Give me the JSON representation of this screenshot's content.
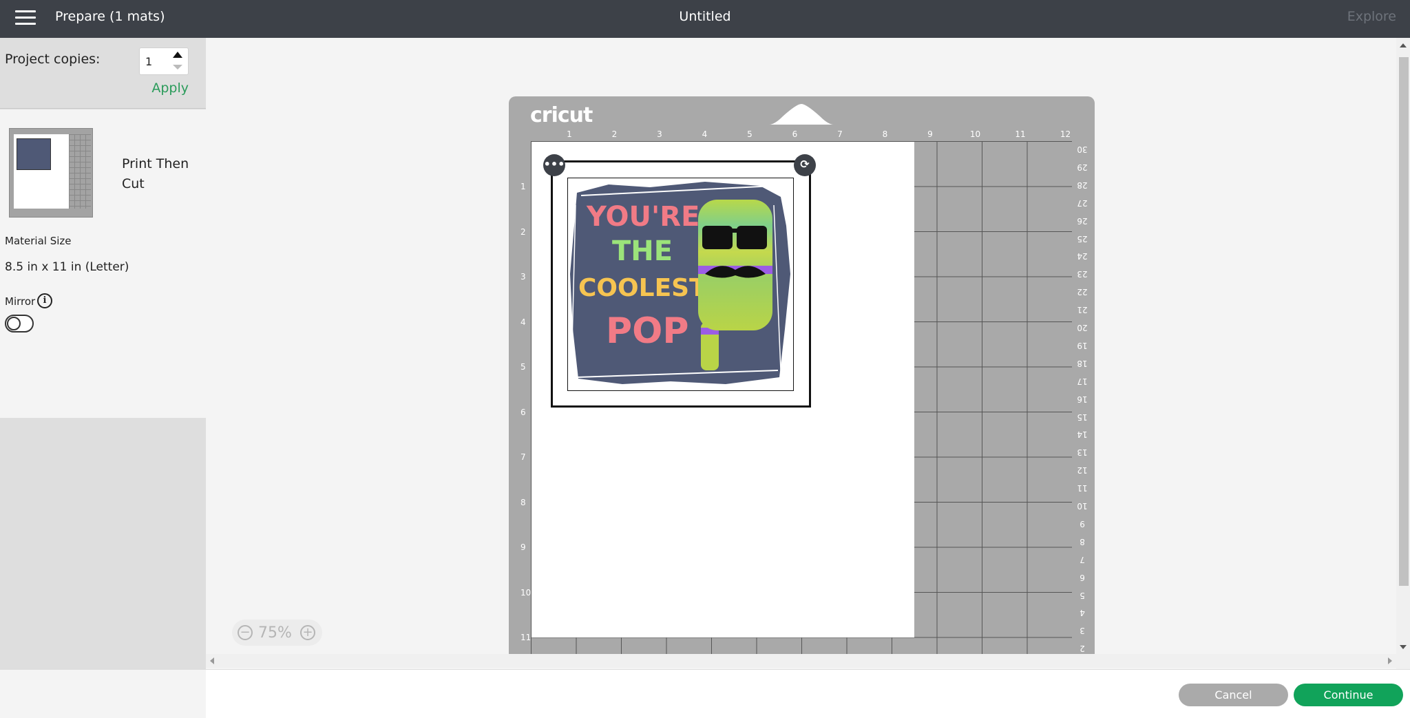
{
  "header": {
    "menu_icon": "hamburger-menu-icon",
    "title": "Prepare (1 mats)",
    "document_title": "Untitled",
    "explore_label": "Explore"
  },
  "left_panel": {
    "project_copies_label": "Project copies:",
    "project_copies_value": "1",
    "apply_label": "Apply",
    "mat": {
      "label": "Print Then Cut",
      "material_size_label": "Material Size",
      "material_size_value": "8.5 in x 11 in (Letter)",
      "mirror_label": "Mirror",
      "mirror_on": false
    }
  },
  "mat_view": {
    "logo_text": "cricut",
    "ruler_top": [
      "1",
      "2",
      "3",
      "4",
      "5",
      "6",
      "7",
      "8",
      "9",
      "10",
      "11",
      "12"
    ],
    "ruler_left": [
      "1",
      "2",
      "3",
      "4",
      "5",
      "6",
      "7",
      "8",
      "9",
      "10",
      "11"
    ],
    "ruler_right": [
      "30",
      "29",
      "28",
      "27",
      "26",
      "25",
      "24",
      "23",
      "22",
      "21",
      "20",
      "19",
      "18",
      "17",
      "16",
      "15",
      "14",
      "13",
      "12",
      "11",
      "10",
      "9",
      "8",
      "7",
      "6",
      "5",
      "4",
      "3",
      "2"
    ],
    "design_text": [
      "YOU'RE",
      "THE",
      "COOLEST",
      "POP"
    ],
    "design_colors": {
      "background": "#4f5976",
      "youre": "#f17b86",
      "the": "#9be37a",
      "coolest": "#f6c451",
      "pop": "#f17b86"
    }
  },
  "zoom": {
    "value": "75%"
  },
  "footer": {
    "cancel_label": "Cancel",
    "continue_label": "Continue"
  },
  "colors": {
    "topbar": "#3d4148",
    "accent_green": "#11a35a",
    "apply_green": "#2a9b5a"
  }
}
